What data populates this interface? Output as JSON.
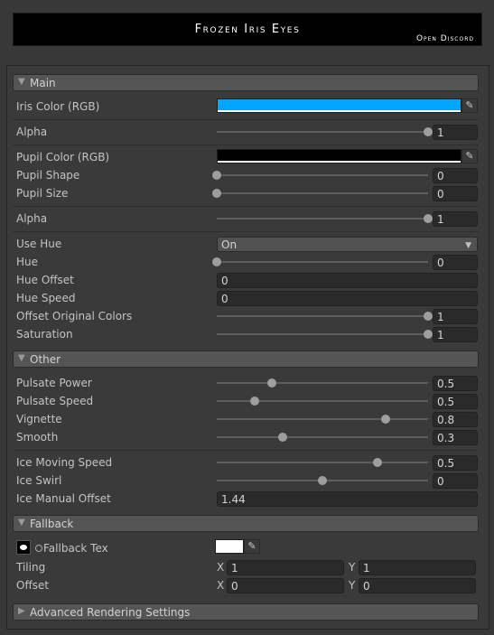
{
  "banner": {
    "title": "Frozen Iris Eyes",
    "link": "Open Discord"
  },
  "sections": {
    "main": "Main",
    "other": "Other",
    "fallback": "Fallback",
    "advanced": "Advanced Rendering Settings"
  },
  "colors": {
    "iris": "#00a6ff",
    "pupil": "#000000",
    "fallback": "#ffffff"
  },
  "main": {
    "iris_color": "Iris Color (RGB)",
    "alpha1_label": "Alpha",
    "alpha1_value": "1",
    "alpha1_level": 1,
    "pupil_color": "Pupil Color (RGB)",
    "pupil_shape_label": "Pupil Shape",
    "pupil_shape_value": "0",
    "pupil_shape_level": 0,
    "pupil_size_label": "Pupil Size",
    "pupil_size_value": "0",
    "pupil_size_level": 0,
    "alpha2_label": "Alpha",
    "alpha2_value": "1",
    "alpha2_level": 1,
    "use_hue_label": "Use Hue",
    "use_hue_value": "On",
    "hue_label": "Hue",
    "hue_value": "0",
    "hue_level": 0,
    "hue_offset_label": "Hue Offset",
    "hue_offset_value": "0",
    "hue_speed_label": "Hue Speed",
    "hue_speed_value": "0",
    "offset_orig_label": "Offset Original Colors",
    "offset_orig_value": "1",
    "offset_orig_level": 1,
    "saturation_label": "Saturation",
    "saturation_value": "1",
    "saturation_level": 1
  },
  "other": {
    "pulsate_power_label": "Pulsate Power",
    "pulsate_power_value": "0.5",
    "pulsate_power_level": 0.26,
    "pulsate_speed_label": "Pulsate Speed",
    "pulsate_speed_value": "0.5",
    "pulsate_speed_level": 0.18,
    "vignette_label": "Vignette",
    "vignette_value": "0.8",
    "vignette_level": 0.8,
    "smooth_label": "Smooth",
    "smooth_value": "0.3",
    "smooth_level": 0.31,
    "ice_moving_label": "Ice Moving Speed",
    "ice_moving_value": "0.5",
    "ice_moving_level": 0.76,
    "ice_swirl_label": "Ice Swirl",
    "ice_swirl_value": "0",
    "ice_swirl_level": 0.5,
    "ice_manual_label": "Ice Manual Offset",
    "ice_manual_value": "1.44"
  },
  "fallback": {
    "tex_label": "Fallback Tex",
    "tiling_label": "Tiling",
    "tiling_x": "1",
    "tiling_y": "1",
    "offset_label": "Offset",
    "offset_x": "0",
    "offset_y": "0",
    "x_label": "X",
    "y_label": "Y"
  },
  "icons": {
    "eyedropper": "eyedropper-icon",
    "expand": "triangle-down-icon",
    "collapse": "triangle-right-icon"
  }
}
